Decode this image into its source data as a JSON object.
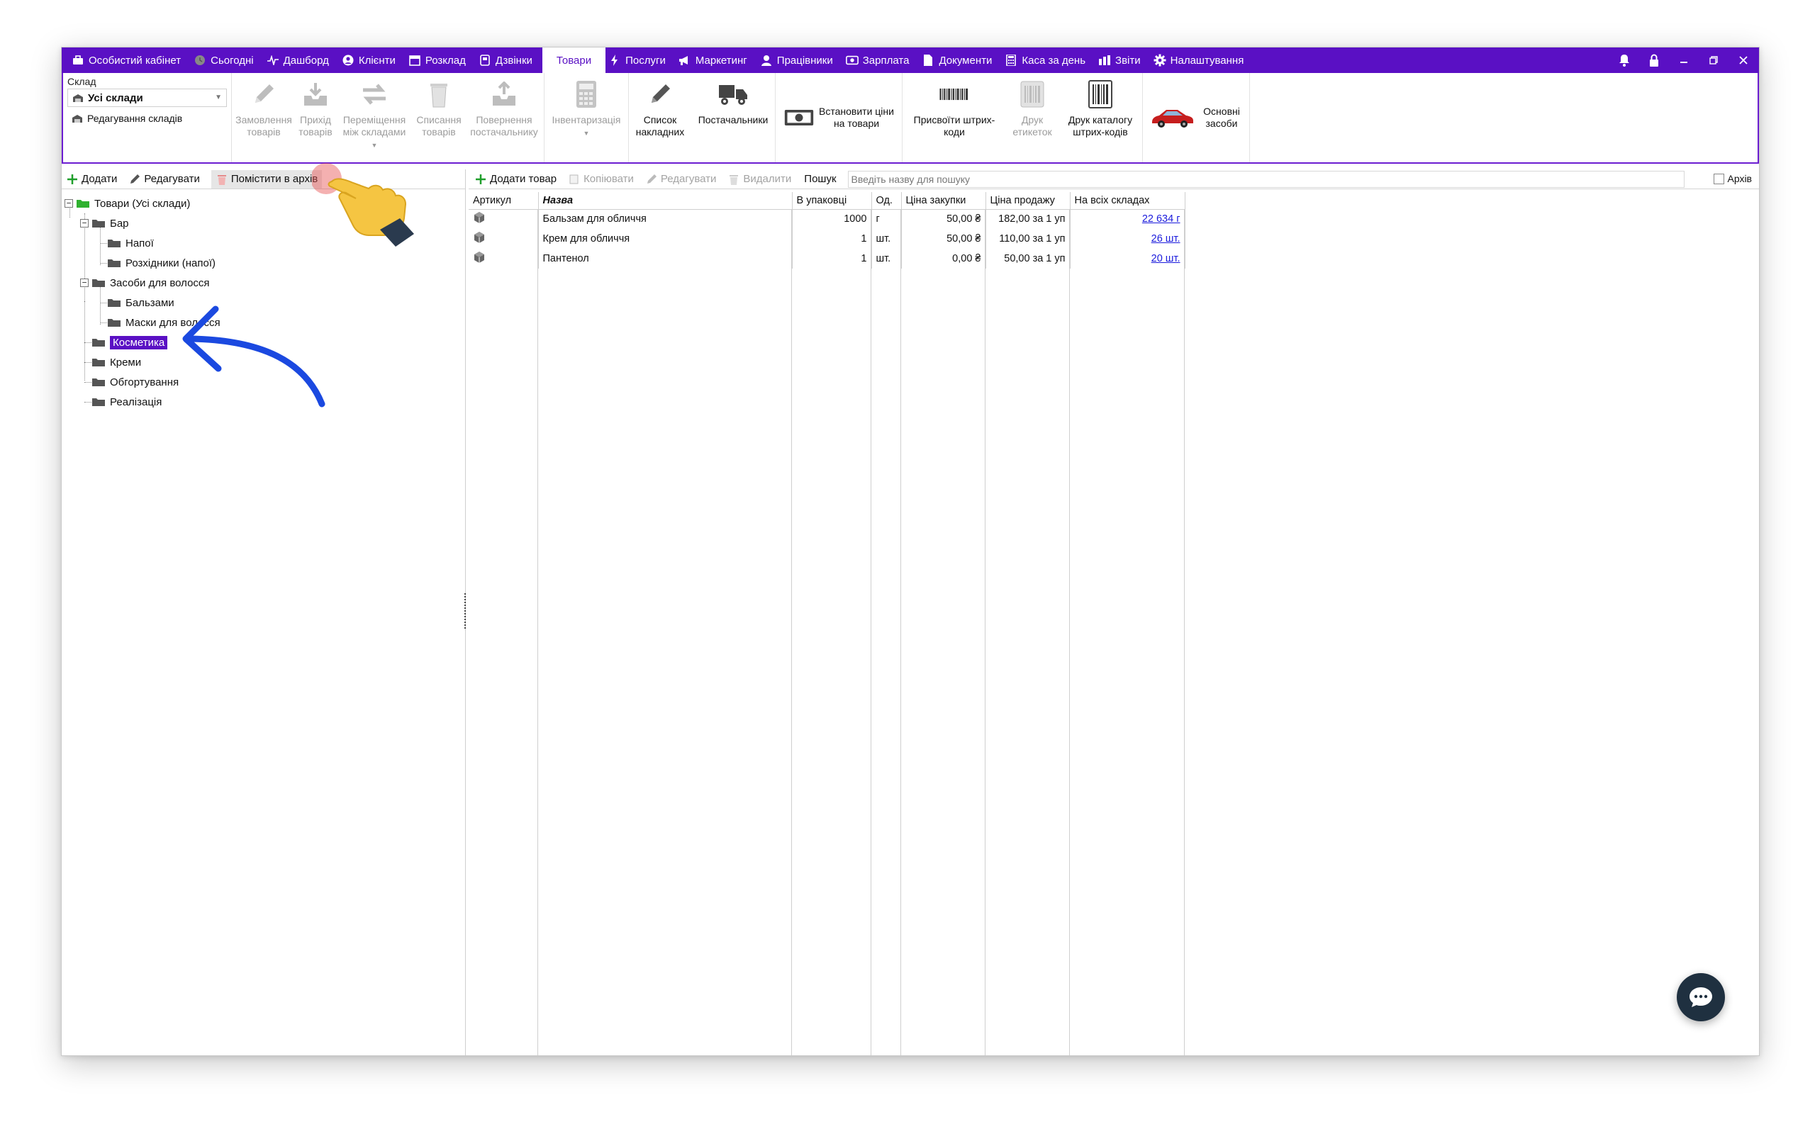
{
  "nav": {
    "items": [
      {
        "label": "Особистий кабінет",
        "icon": "briefcase-icon"
      },
      {
        "label": "Сьогодні",
        "icon": "clock-icon"
      },
      {
        "label": "Дашборд",
        "icon": "pulse-icon"
      },
      {
        "label": "Клієнти",
        "icon": "user-circle-icon"
      },
      {
        "label": "Розклад",
        "icon": "calendar-icon"
      },
      {
        "label": "Дзвінки",
        "icon": "phone-icon"
      },
      {
        "label": "Товари",
        "icon": "",
        "active": true
      },
      {
        "label": "Послуги",
        "icon": "bolt-icon"
      },
      {
        "label": "Маркетинг",
        "icon": "megaphone-icon"
      },
      {
        "label": "Працівники",
        "icon": "person-icon"
      },
      {
        "label": "Зарплата",
        "icon": "money-icon"
      },
      {
        "label": "Документи",
        "icon": "document-icon"
      },
      {
        "label": "Каса за день",
        "icon": "calculator-icon"
      },
      {
        "label": "Звіти",
        "icon": "bar-chart-icon"
      },
      {
        "label": "Налаштування",
        "icon": "gear-icon"
      }
    ]
  },
  "ribbon": {
    "warehouse_label": "Склад",
    "warehouse_value": "Усі склади",
    "edit_warehouses": "Редагування складів",
    "buttons": {
      "order": "Замовлення товарів",
      "receipt": "Прихід товарів",
      "transfer": "Переміщення між складами",
      "writeoff": "Списання товарів",
      "return": "Повернення постачальнику",
      "inventory": "Інвентаризація",
      "invoices": "Список накладних",
      "suppliers": "Постачальники",
      "set_prices": "Встановити ціни на товари",
      "assign_barcodes": "Присвоїти штрих-коди",
      "print_labels": "Друк етикеток",
      "print_catalog": "Друк каталогу штрих-кодів",
      "fixed_assets": "Основні засоби"
    }
  },
  "left_toolbar": {
    "add": "Додати",
    "edit": "Редагувати",
    "archive": "Помістити в архів"
  },
  "tree": {
    "root": "Товари (Усі склади)",
    "bar": "Бар",
    "drinks": "Напої",
    "drinks_cons": "Розхідники (напої)",
    "hair": "Засоби для волосся",
    "balms": "Бальзами",
    "masks": "Маски для волосся",
    "cosmetics": "Косметика",
    "creams": "Креми",
    "wraps": "Обгортування",
    "sales": "Реалізація"
  },
  "right_toolbar": {
    "add_product": "Додати товар",
    "copy": "Копіювати",
    "edit": "Редагувати",
    "delete": "Видалити",
    "search_label": "Пошук",
    "search_placeholder": "Введіть назву для пошуку",
    "archive": "Архів"
  },
  "table": {
    "headers": [
      "Артикул",
      "Назва",
      "В упаковці",
      "Од.",
      "Ціна закупки",
      "Ціна продажу",
      "На всіх складах"
    ],
    "rows": [
      {
        "name": "Бальзам для обличчя",
        "pack": "1000",
        "unit": "г",
        "buy": "50,00 ₴",
        "sell": "182,00 за 1 уп",
        "stock": "22 634 г"
      },
      {
        "name": "Крем для обличчя",
        "pack": "1",
        "unit": "шт.",
        "buy": "50,00 ₴",
        "sell": "110,00 за 1 уп",
        "stock": "26 шт."
      },
      {
        "name": "Пантенол",
        "pack": "1",
        "unit": "шт.",
        "buy": "0,00 ₴",
        "sell": "50,00 за 1 уп",
        "stock": "20 шт."
      }
    ]
  },
  "colors": {
    "accent": "#5a10c4",
    "link": "#1a1adc",
    "arrow": "#1b49e0"
  }
}
